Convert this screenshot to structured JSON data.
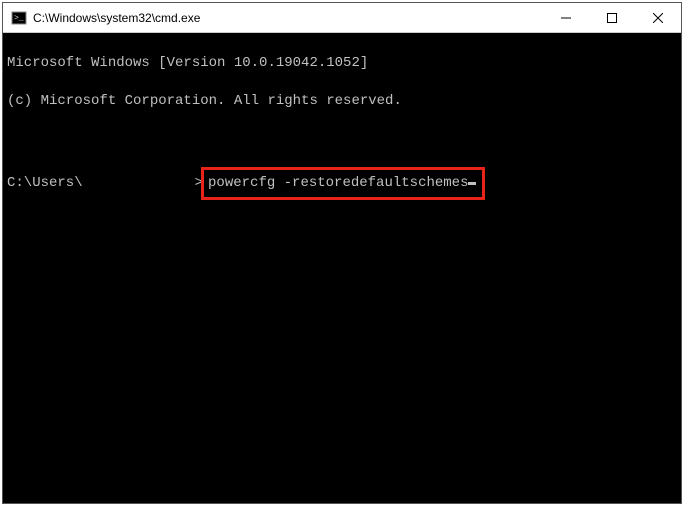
{
  "titlebar": {
    "title": "C:\\Windows\\system32\\cmd.exe"
  },
  "terminal": {
    "line1": "Microsoft Windows [Version 10.0.19042.1052]",
    "line2": "(c) Microsoft Corporation. All rights reserved.",
    "prompt_prefix": "C:\\Users\\",
    "prompt_suffix": ">",
    "command": "powercfg -restoredefaultschemes"
  }
}
